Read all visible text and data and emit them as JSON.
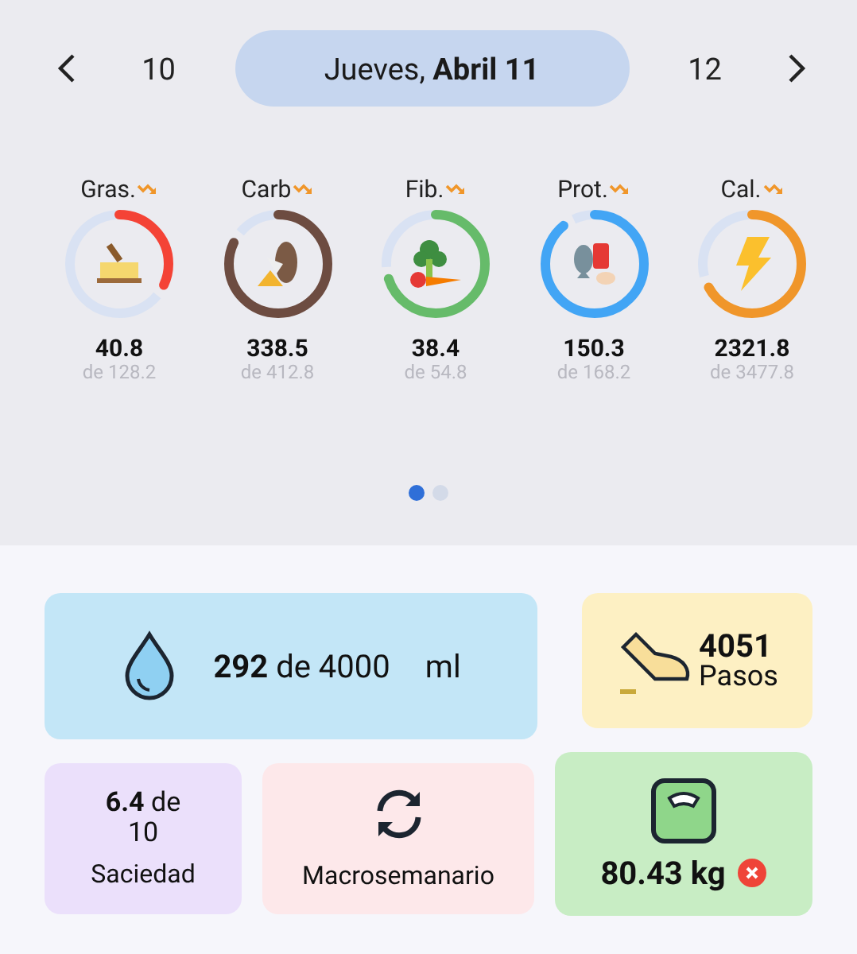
{
  "date_nav": {
    "prev_day": "10",
    "current": "Jueves, **Abril 11**",
    "next_day": "12"
  },
  "nutrients": [
    {
      "label": "Gras.",
      "kind": "fat",
      "level": 0.32,
      "color": "#f44336",
      "value": "40.8",
      "target": "de 128.2"
    },
    {
      "label": "Carb",
      "kind": "carb",
      "level": 0.82,
      "color": "#6d4c41",
      "value": "338.5",
      "target": "de 412.8"
    },
    {
      "label": "Fib.",
      "kind": "fiber",
      "level": 0.7,
      "color": "#66bb6a",
      "value": "38.4",
      "target": "de 54.8"
    },
    {
      "label": "Prot.",
      "kind": "protein",
      "level": 0.89,
      "color": "#42a5f5",
      "value": "150.3",
      "target": "de 168.2"
    },
    {
      "label": "Cal.",
      "kind": "calories",
      "level": 0.67,
      "color": "#f0962a",
      "value": "2321.8",
      "target": "de 3477.8"
    }
  ],
  "pages": [
    {
      "selected": true
    },
    {
      "selected": false
    }
  ],
  "water": {
    "amount": "**292** de 4000",
    "unit": "ml"
  },
  "steps": {
    "count": "4051",
    "label": "Pasos"
  },
  "satiety": {
    "value": "**6.4** de 10",
    "label": "Saciedad"
  },
  "macro_week": {
    "label": "Macrosemanario"
  },
  "weight": {
    "value": "80.43 kg"
  }
}
